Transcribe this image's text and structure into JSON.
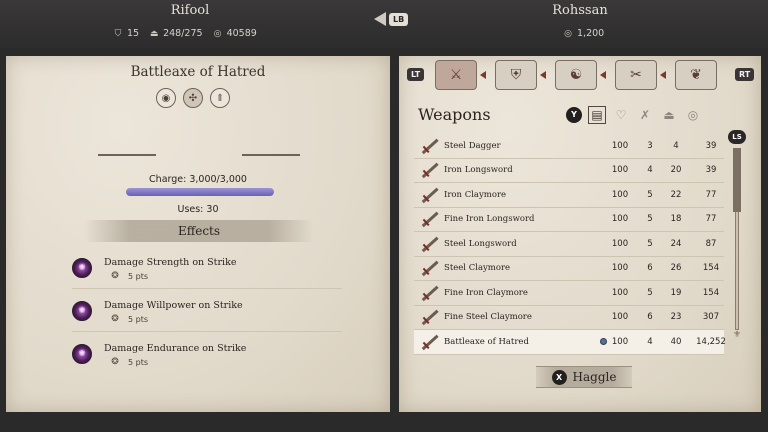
{
  "top": {
    "player": {
      "name": "Rifool",
      "level": "15",
      "weight": "248/275",
      "gold": "40589"
    },
    "merchant": {
      "name": "Rohssan",
      "gold": "1,200"
    },
    "switch_button": "LB"
  },
  "item_panel": {
    "title": "Battleaxe of Hatred",
    "charge_label": "Charge: 3,000/3,000",
    "charge_fraction": 1.0,
    "uses": "Uses: 30",
    "effects_header": "Effects",
    "effects": [
      {
        "name": "Damage Strength on Strike",
        "magnitude": "5 pts"
      },
      {
        "name": "Damage Willpower on Strike",
        "magnitude": "5 pts"
      },
      {
        "name": "Damage Endurance on Strike",
        "magnitude": "5 pts"
      }
    ]
  },
  "tabs": {
    "left_trigger": "LT",
    "right_trigger": "RT"
  },
  "inventory": {
    "title": "Weapons",
    "sort_button": "Y",
    "scroll_badge": "LS",
    "rows": [
      {
        "name": "Steel Dagger",
        "condition": "100",
        "weight": "3",
        "damage": "4",
        "value": "39"
      },
      {
        "name": "Iron Longsword",
        "condition": "100",
        "weight": "4",
        "damage": "20",
        "value": "39"
      },
      {
        "name": "Iron Claymore",
        "condition": "100",
        "weight": "5",
        "damage": "22",
        "value": "77"
      },
      {
        "name": "Fine Iron Longsword",
        "condition": "100",
        "weight": "5",
        "damage": "18",
        "value": "77"
      },
      {
        "name": "Steel Longsword",
        "condition": "100",
        "weight": "5",
        "damage": "24",
        "value": "87"
      },
      {
        "name": "Steel Claymore",
        "condition": "100",
        "weight": "6",
        "damage": "26",
        "value": "154"
      },
      {
        "name": "Fine Iron Claymore",
        "condition": "100",
        "weight": "5",
        "damage": "19",
        "value": "154"
      },
      {
        "name": "Fine Steel Claymore",
        "condition": "100",
        "weight": "6",
        "damage": "23",
        "value": "307"
      },
      {
        "name": "Battleaxe of Hatred",
        "condition": "100",
        "weight": "4",
        "damage": "40",
        "value": "14,252"
      }
    ]
  },
  "haggle": {
    "button": "X",
    "label": "Haggle"
  }
}
